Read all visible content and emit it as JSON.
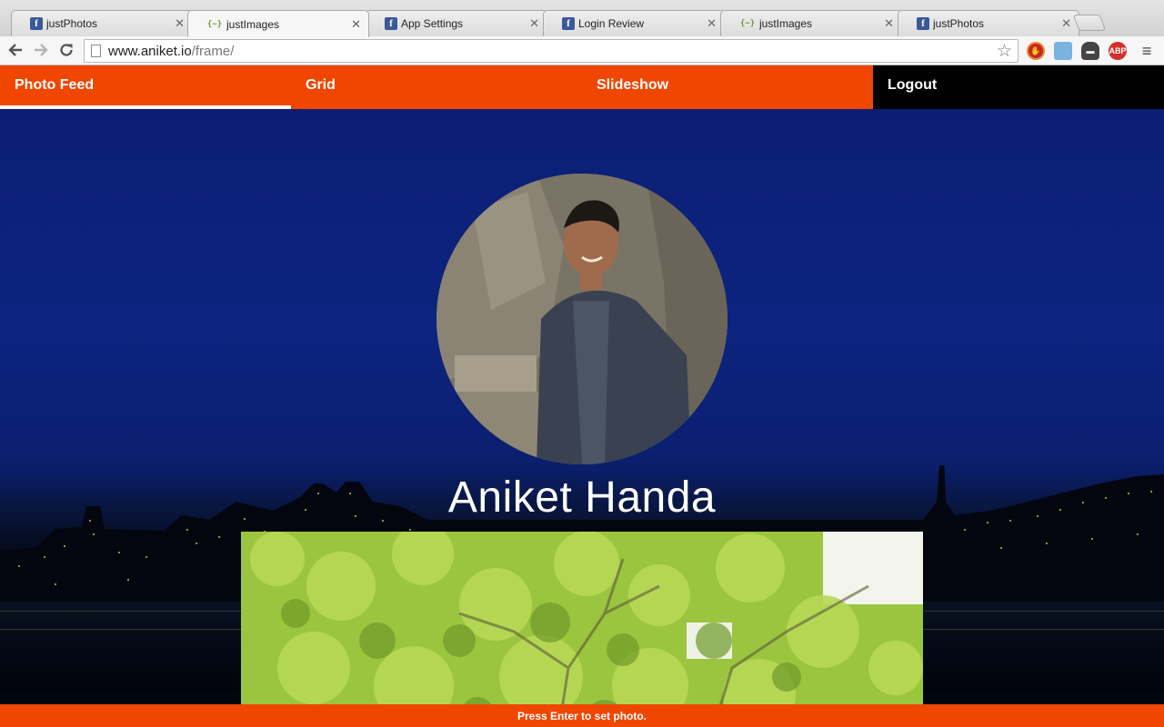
{
  "browser": {
    "tabs": [
      {
        "title": "justPhotos",
        "icon": "facebook-icon"
      },
      {
        "title": "justImages",
        "icon": "code-icon"
      },
      {
        "title": "App Settings",
        "icon": "facebook-icon"
      },
      {
        "title": "Login Review",
        "icon": "facebook-icon"
      },
      {
        "title": "justImages",
        "icon": "code-icon"
      },
      {
        "title": "justPhotos",
        "icon": "facebook-icon"
      }
    ],
    "active_tab": 1,
    "url_host": "www.aniket.io",
    "url_path": "/frame/",
    "extensions": [
      "ublock-icon",
      "screenshot-icon",
      "incognito-icon",
      "adblock-icon",
      "menu-icon"
    ]
  },
  "nav": {
    "items": [
      {
        "label": "Photo Feed",
        "active": true
      },
      {
        "label": "Grid",
        "active": false
      },
      {
        "label": "Slideshow",
        "active": false
      },
      {
        "label": "Logout",
        "active": false
      }
    ]
  },
  "profile": {
    "name": "Aniket Handa"
  },
  "status": {
    "message": "Press Enter to set photo."
  },
  "colors": {
    "accent": "#f04600",
    "logout_bg": "#000000",
    "sky": "#0c2480"
  }
}
